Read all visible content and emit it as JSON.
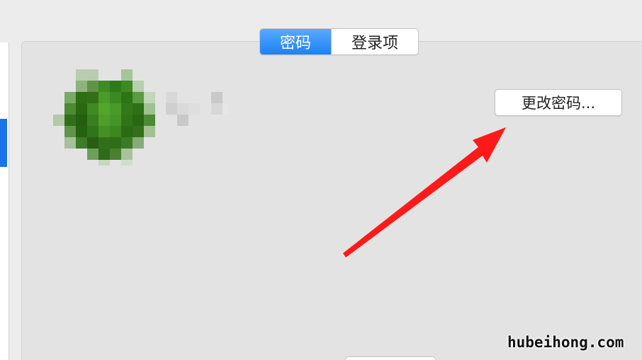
{
  "tabs": [
    {
      "label": "密码",
      "selected": true
    },
    {
      "label": "登录项",
      "selected": false
    }
  ],
  "user": {
    "avatar_icon": "user-avatar-pixelated",
    "name_obscured": true
  },
  "buttons": {
    "change_password_label": "更改密码..."
  },
  "annotation": {
    "arrow_color": "#ff1a1a",
    "arrow_icon": "red-arrow-pointing-to-button"
  },
  "watermark": {
    "text": "hubeihong.com"
  },
  "colors": {
    "accent": "#1c82f3",
    "panel_bg": "#e3e3e3",
    "window_bg": "#ececec"
  }
}
